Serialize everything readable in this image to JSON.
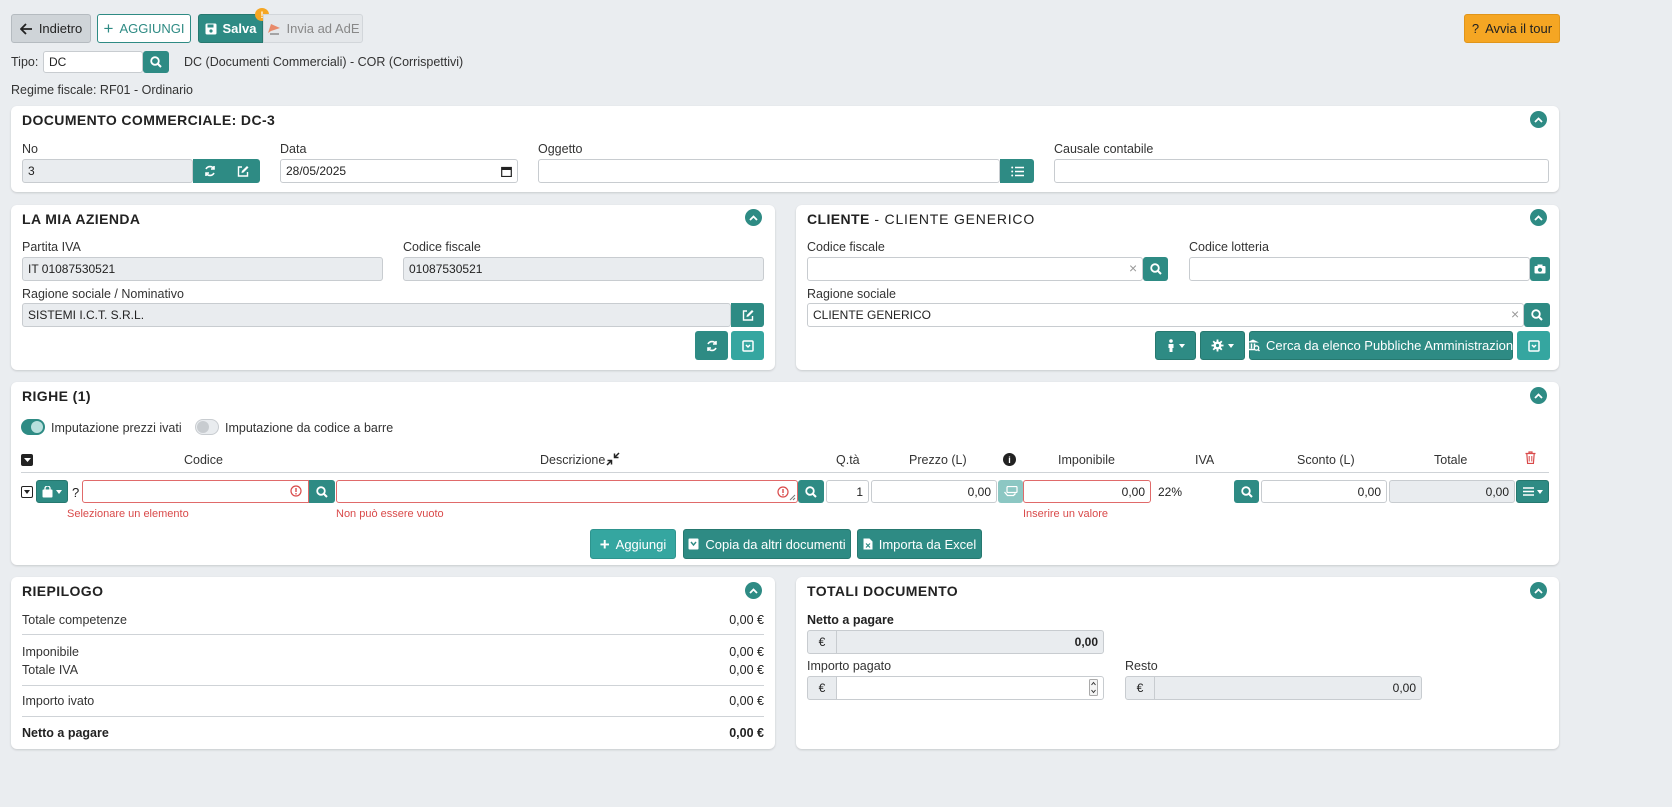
{
  "toolbar": {
    "back_label": "Indietro",
    "add_label": "AGGIUNGI",
    "save_label": "Salva",
    "send_label": "Invia ad AdE",
    "tour_label": "Avvia il tour",
    "warn_badge": "!"
  },
  "tipo": {
    "label": "Tipo:",
    "value": "DC",
    "description": "DC (Documenti Commerciali) - COR (Corrispettivi)"
  },
  "regime": "Regime fiscale: RF01 - Ordinario",
  "documento": {
    "title": "DOCUMENTO COMMERCIALE: DC-3",
    "no_label": "No",
    "no_value": "3",
    "data_label": "Data",
    "data_value": "28/05/2025",
    "oggetto_label": "Oggetto",
    "oggetto_value": "",
    "causale_label": "Causale contabile",
    "causale_value": ""
  },
  "azienda": {
    "title": "LA MIA AZIENDA",
    "piva_label": "Partita IVA",
    "piva_value": "IT 01087530521",
    "cf_label": "Codice fiscale",
    "cf_value": "01087530521",
    "rs_label": "Ragione sociale / Nominativo",
    "rs_value": "SISTEMI I.C.T. S.R.L."
  },
  "cliente": {
    "title_main": "CLIENTE",
    "title_sub": " - CLIENTE GENERICO",
    "cf_label": "Codice fiscale",
    "cf_value": "",
    "lotteria_label": "Codice lotteria",
    "lotteria_value": "",
    "rs_label": "Ragione sociale",
    "rs_value": "CLIENTE GENERICO",
    "pa_label": "Cerca da elenco Pubbliche Amministrazioni"
  },
  "righe": {
    "title": "RIGHE (1)",
    "toggle1": "Imputazione prezzi ivati",
    "toggle1_on": true,
    "toggle2": "Imputazione da codice a barre",
    "toggle2_on": false,
    "columns": {
      "codice": "Codice",
      "descrizione": "Descrizione",
      "qta": "Q.tà",
      "prezzo": "Prezzo (L)",
      "imponibile": "Imponibile",
      "iva": "IVA",
      "sconto": "Sconto (L)",
      "totale": "Totale"
    },
    "row": {
      "codice": "?",
      "descrizione": "",
      "qta": "1",
      "prezzo": "0,00",
      "imponibile": "0,00",
      "iva": "22%",
      "sconto": "0,00",
      "totale": "0,00"
    },
    "errors": {
      "codice": "Selezionare un elemento",
      "descrizione": "Non può essere vuoto",
      "imponibile": "Inserire un valore"
    },
    "add_label": "Aggiungi",
    "copy_label": "Copia da altri documenti",
    "excel_label": "Importa da Excel"
  },
  "riepilogo": {
    "title": "RIEPILOGO",
    "competenze_label": "Totale competenze",
    "competenze_value": "0,00 €",
    "imponibile_label": "Imponibile",
    "imponibile_value": "0,00 €",
    "iva_label": "Totale IVA",
    "iva_value": "0,00 €",
    "ivato_label": "Importo ivato",
    "ivato_value": "0,00 €",
    "netto_label": "Netto a pagare",
    "netto_value": "0,00 €"
  },
  "totali": {
    "title": "TOTALI DOCUMENTO",
    "netto_label": "Netto a pagare",
    "netto_value": "0,00",
    "currency": "€",
    "pagato_label": "Importo pagato",
    "pagato_value": "",
    "resto_label": "Resto",
    "resto_value": "0,00"
  },
  "colors": {
    "accent": "#2e8b84",
    "warning": "#f5a623",
    "error": "#d94a4a"
  }
}
